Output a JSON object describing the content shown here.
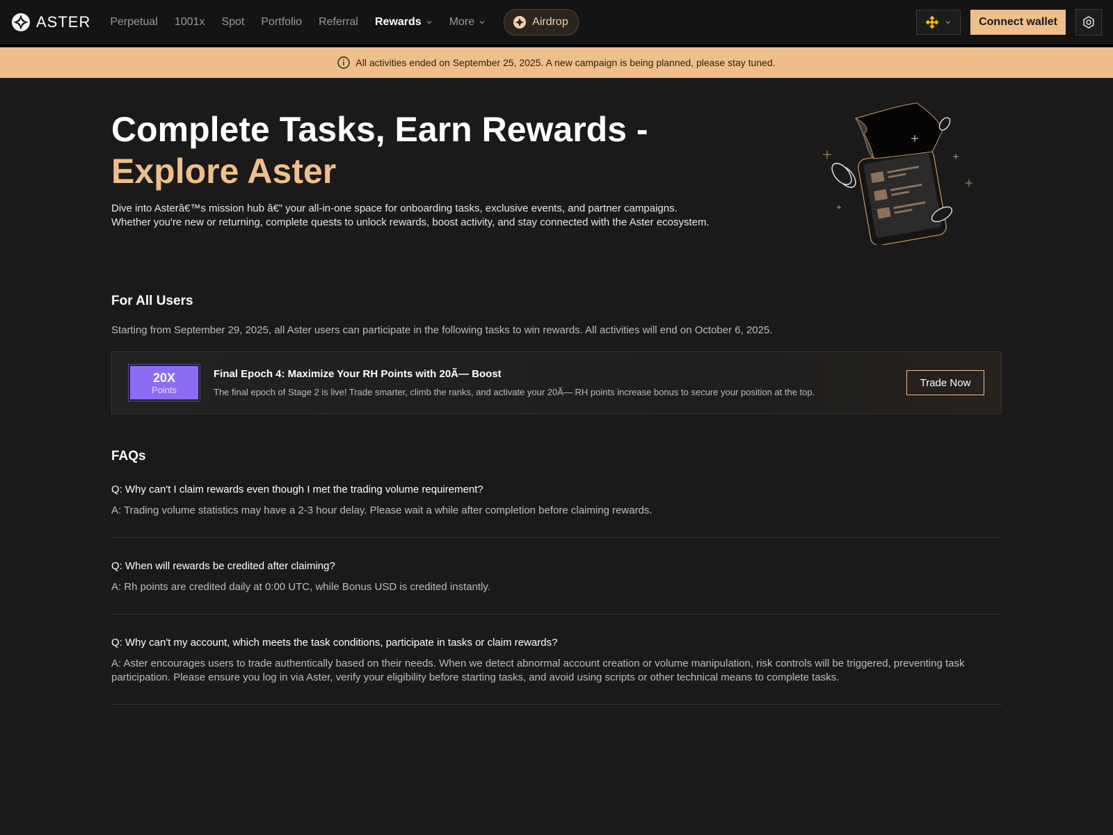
{
  "header": {
    "logo_text": "ASTER",
    "nav": [
      {
        "label": "Perpetual"
      },
      {
        "label": "1001x"
      },
      {
        "label": "Spot"
      },
      {
        "label": "Portfolio"
      },
      {
        "label": "Referral"
      },
      {
        "label": "Rewards"
      },
      {
        "label": "More"
      }
    ],
    "airdrop_label": "Airdrop",
    "connect_label": "Connect wallet"
  },
  "banner": {
    "text": "All activities ended on September 25, 2025. A new campaign is being planned, please stay tuned."
  },
  "hero": {
    "title_line1": "Complete Tasks, Earn Rewards -",
    "title_line2": "Explore Aster",
    "desc_line1": "Dive into Asterâ€™s mission hub â€” your all-in-one space for onboarding tasks, exclusive events, and partner campaigns.",
    "desc_line2": "Whether you're new or returning, complete quests to unlock rewards, boost activity, and stay connected with the Aster ecosystem."
  },
  "for_all_users": {
    "title": "For All Users",
    "subtitle": "Starting from September 29, 2025, all Aster users can participate in the following tasks to win rewards. All activities will end on October 6, 2025.",
    "task": {
      "badge_big": "20X",
      "badge_small": "Points",
      "title": "Final Epoch 4: Maximize Your RH Points with 20Ã— Boost",
      "desc": "The final epoch of Stage 2 is live! Trade smarter, climb the ranks, and activate your 20Ã— RH points increase bonus to secure your position at the top.",
      "button": "Trade Now"
    }
  },
  "faqs": {
    "title": "FAQs",
    "items": [
      {
        "q": "Q: Why can't I claim rewards even though I met the trading volume requirement?",
        "a": "A: Trading volume statistics may have a 2-3 hour delay. Please wait a while after completion before claiming rewards."
      },
      {
        "q": "Q: When will rewards be credited after claiming?",
        "a": "A: Rh points are credited daily at 0:00 UTC, while Bonus USD is credited instantly."
      },
      {
        "q": "Q: Why can't my account, which meets the task conditions, participate in tasks or claim rewards?",
        "a": "A: Aster encourages users to trade authentically based on their needs. When we detect abnormal account creation or volume manipulation, risk controls will be triggered, preventing task participation. Please ensure you log in via Aster, verify your eligibility before starting tasks, and avoid using scripts or other technical means to complete tasks."
      }
    ]
  },
  "colors": {
    "accent": "#efbf8b",
    "background": "#1a1a1a",
    "badge_purple": "#8b6cf5"
  }
}
